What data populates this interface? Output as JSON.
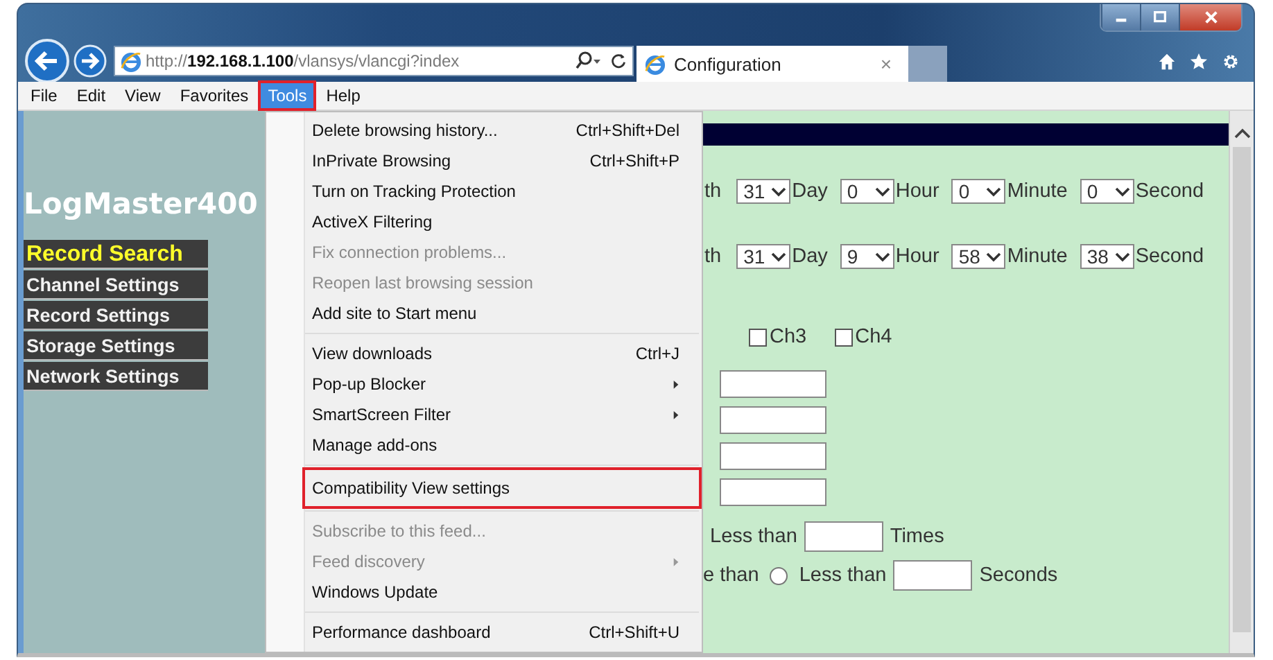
{
  "window": {
    "controls": [
      {
        "kind": "minimize"
      },
      {
        "kind": "maximize"
      },
      {
        "kind": "close"
      }
    ]
  },
  "address_bar": {
    "url": "http://**192.168.1.100**/vlansys/vlancgi?index"
  },
  "tabs": [
    {
      "title": "Configuration",
      "selected": true,
      "close": "×"
    }
  ],
  "menu_bar": [
    {
      "label": "File",
      "selected": false,
      "highlighted": false
    },
    {
      "label": "Edit",
      "selected": false,
      "highlighted": false
    },
    {
      "label": "View",
      "selected": false,
      "highlighted": false
    },
    {
      "label": "Favorites",
      "selected": false,
      "highlighted": false
    },
    {
      "label": "Tools",
      "selected": true,
      "highlighted": true
    },
    {
      "label": "Help",
      "selected": false,
      "highlighted": false
    }
  ],
  "sidebar": {
    "logo": "LogMaster400",
    "items": [
      {
        "label": "Record Search",
        "selected": true
      },
      {
        "label": "Channel Settings",
        "selected": false
      },
      {
        "label": "Record Settings",
        "selected": false
      },
      {
        "label": "Storage Settings",
        "selected": false
      },
      {
        "label": "Network Settings",
        "selected": false
      }
    ]
  },
  "tools_menu": {
    "groups": [
      [
        {
          "label": "Delete browsing history...",
          "shortcut": "Ctrl+Shift+Del",
          "disabled": false,
          "submenu": false,
          "highlighted": false
        },
        {
          "label": "InPrivate Browsing",
          "shortcut": "Ctrl+Shift+P",
          "disabled": false,
          "submenu": false,
          "highlighted": false
        },
        {
          "label": "Turn on Tracking Protection",
          "disabled": false,
          "submenu": false,
          "highlighted": false
        },
        {
          "label": "ActiveX Filtering",
          "disabled": false,
          "submenu": false,
          "highlighted": false
        },
        {
          "label": "Fix connection problems...",
          "disabled": true,
          "submenu": false,
          "highlighted": false
        },
        {
          "label": "Reopen last browsing session",
          "disabled": true,
          "submenu": false,
          "highlighted": false
        },
        {
          "label": "Add site to Start menu",
          "disabled": false,
          "submenu": false,
          "highlighted": false
        }
      ],
      [
        {
          "label": "View downloads",
          "shortcut": "Ctrl+J",
          "disabled": false,
          "submenu": false,
          "highlighted": false
        },
        {
          "label": "Pop-up Blocker",
          "disabled": false,
          "submenu": true,
          "highlighted": false
        },
        {
          "label": "SmartScreen Filter",
          "disabled": false,
          "submenu": true,
          "highlighted": false
        },
        {
          "label": "Manage add-ons",
          "disabled": false,
          "submenu": false,
          "highlighted": false
        }
      ],
      [
        {
          "label": "Compatibility View settings",
          "disabled": false,
          "submenu": false,
          "highlighted": true
        }
      ],
      [
        {
          "label": "Subscribe to this feed...",
          "disabled": true,
          "submenu": false,
          "highlighted": false
        },
        {
          "label": "Feed discovery",
          "disabled": true,
          "submenu": true,
          "highlighted": false
        },
        {
          "label": "Windows Update",
          "disabled": false,
          "submenu": false,
          "highlighted": false
        }
      ],
      [
        {
          "label": "Performance dashboard",
          "shortcut": "Ctrl+Shift+U",
          "disabled": false,
          "submenu": false,
          "highlighted": false
        }
      ]
    ]
  },
  "form": {
    "time_rows": [
      {
        "label": "th",
        "fields": [
          {
            "value": "31",
            "unit": "Day"
          },
          {
            "value": "0",
            "unit": "Hour"
          },
          {
            "value": "0",
            "unit": "Minute"
          },
          {
            "value": "0",
            "unit": "Second"
          }
        ]
      },
      {
        "label": "th",
        "fields": [
          {
            "value": "31",
            "unit": "Day"
          },
          {
            "value": "9",
            "unit": "Hour"
          },
          {
            "value": "58",
            "unit": "Minute"
          },
          {
            "value": "38",
            "unit": "Second"
          }
        ]
      }
    ],
    "channels": [
      {
        "label": "Ch3",
        "checked": false
      },
      {
        "label": "Ch4",
        "checked": false
      }
    ],
    "text_fields": [
      {
        "kind": "text"
      },
      {
        "kind": "text"
      },
      {
        "kind": "text"
      },
      {
        "kind": "text"
      }
    ],
    "count_row": {
      "label": "Less than",
      "unit": "Times"
    },
    "duration_row": {
      "label": "e than",
      "radio_selected": false,
      "option": "Less than",
      "unit": "Seconds"
    }
  }
}
